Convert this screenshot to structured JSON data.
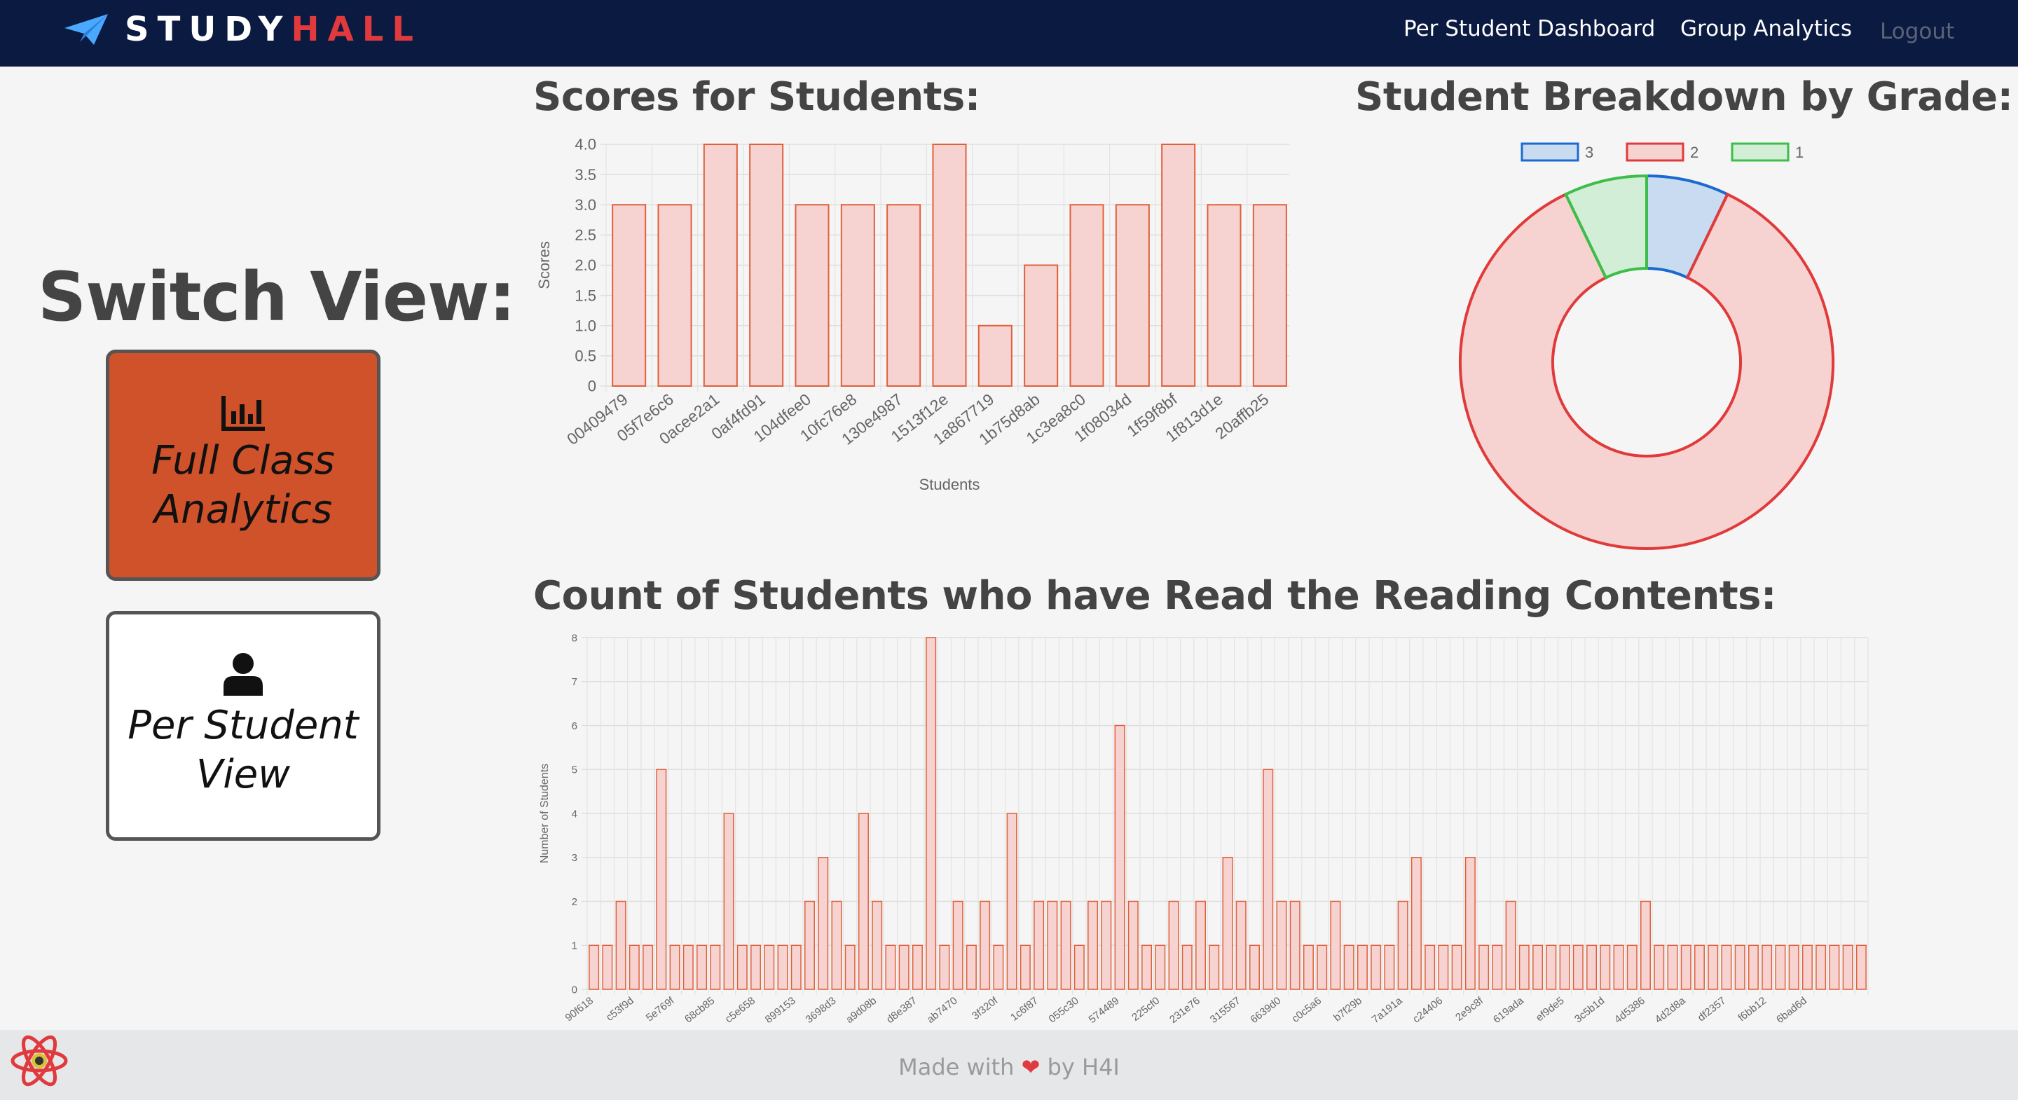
{
  "navbar": {
    "brand_part1": "STUDY",
    "brand_part2": "HALL",
    "links": {
      "per_student": "Per Student Dashboard",
      "group": "Group Analytics",
      "logout": "Logout"
    }
  },
  "sidebar": {
    "title": "Switch View:",
    "full_class_label": "Full Class Analytics",
    "per_student_label": "Per Student View"
  },
  "scores_chart": {
    "title": "Scores for Students:",
    "chart_data": {
      "type": "bar",
      "categories": [
        "00409479",
        "05f7e6c6",
        "0acee2a1",
        "0af4fd91",
        "104dfee0",
        "10fc76e8",
        "130e4987",
        "1513f12e",
        "1a867719",
        "1b75d8ab",
        "1c3ea8c0",
        "1f08034d",
        "1f59f8bf",
        "1f813d1e",
        "20affb25"
      ],
      "values": [
        3,
        3,
        4,
        4,
        3,
        3,
        3,
        4,
        1,
        2,
        3,
        3,
        4,
        3,
        3
      ],
      "xlabel": "Students",
      "ylabel": "Scores",
      "ylim": [
        0,
        4
      ],
      "yticks": [
        "0",
        "0.5",
        "1.0",
        "1.5",
        "2.0",
        "2.5",
        "3.0",
        "3.5",
        "4.0"
      ],
      "bar_fill": "#f6d3d1",
      "bar_stroke": "#e0603a",
      "grid": true
    }
  },
  "grade_chart": {
    "title": "Student Breakdown by Grade:",
    "chart_data": {
      "type": "pie",
      "labels": [
        "3",
        "2",
        "1"
      ],
      "values": [
        1,
        12,
        1
      ],
      "fills": [
        "#c9dbf0",
        "#f6d3d1",
        "#d3eed6"
      ],
      "strokes": [
        "#1a6ad0",
        "#e03a3a",
        "#3dbd4a"
      ],
      "legend": "top"
    }
  },
  "reading_chart": {
    "title": "Count of Students who have Read the Reading Contents:",
    "chart_data": {
      "type": "bar",
      "categories": [
        "90f618",
        "",
        "",
        "c53f9d",
        "",
        "",
        "5e769f",
        "",
        "",
        "68cb85",
        "",
        "",
        "c5e658",
        "",
        "",
        "899153",
        "",
        "",
        "3698d3",
        "",
        "",
        "a9d08b",
        "",
        "",
        "d8e387",
        "",
        "",
        "ab7470",
        "",
        "",
        "3f320f",
        "",
        "",
        "1c6f87",
        "",
        "",
        "055c30",
        "",
        "",
        "574489",
        "",
        "",
        "225cf0",
        "",
        "",
        "231e76",
        "",
        "",
        "315567",
        "",
        "",
        "6639d0",
        "",
        "",
        "c0c5a6",
        "",
        "",
        "b7f29b",
        "",
        "",
        "7a191a",
        "",
        "",
        "c24406",
        "",
        "",
        "2e9c8f",
        "",
        "",
        "619ada",
        "",
        "",
        "ef9de5",
        "",
        "",
        "3c5b1d",
        "",
        "",
        "4d5386",
        "",
        "",
        "4d2d8a",
        "",
        "",
        "df2357",
        "",
        "",
        "f6bb12",
        "",
        "",
        "6bad6d",
        "",
        "",
        ""
      ],
      "values": [
        1,
        1,
        2,
        1,
        1,
        5,
        1,
        1,
        1,
        1,
        4,
        1,
        1,
        1,
        1,
        1,
        2,
        3,
        2,
        1,
        4,
        2,
        1,
        1,
        1,
        8,
        1,
        2,
        1,
        2,
        1,
        4,
        1,
        2,
        2,
        2,
        1,
        2,
        2,
        6,
        2,
        1,
        1,
        2,
        1,
        2,
        1,
        3,
        2,
        1,
        5,
        2,
        2,
        1,
        1,
        2,
        1,
        1,
        1,
        1,
        2,
        3,
        1,
        1,
        1,
        3,
        1,
        1,
        2,
        1,
        1,
        1,
        1,
        1,
        1,
        1,
        1,
        1,
        2,
        1,
        1,
        1,
        1,
        1,
        1,
        1,
        1,
        1,
        1,
        1,
        1,
        1,
        1,
        1,
        1
      ],
      "xlabel": "",
      "ylabel": "Number of Students",
      "ylim": [
        0,
        8
      ],
      "yticks": [
        "0",
        "1",
        "2",
        "3",
        "4",
        "5",
        "6",
        "7",
        "8"
      ],
      "bar_fill": "#f6d3d1",
      "bar_stroke": "#e0603a",
      "grid": true
    }
  },
  "footer": {
    "made_with": "Made with",
    "by": "by H4I"
  },
  "colors": {
    "navbar": "#0b1a40",
    "accent_red": "#e0393e",
    "active_button": "#d0522a",
    "footer": "#e6e7e8"
  },
  "icons": {
    "brand": "paper-plane-icon",
    "full_class": "bar-chart-icon",
    "per_student": "user-icon",
    "footer_logo": "react-logo-icon"
  }
}
